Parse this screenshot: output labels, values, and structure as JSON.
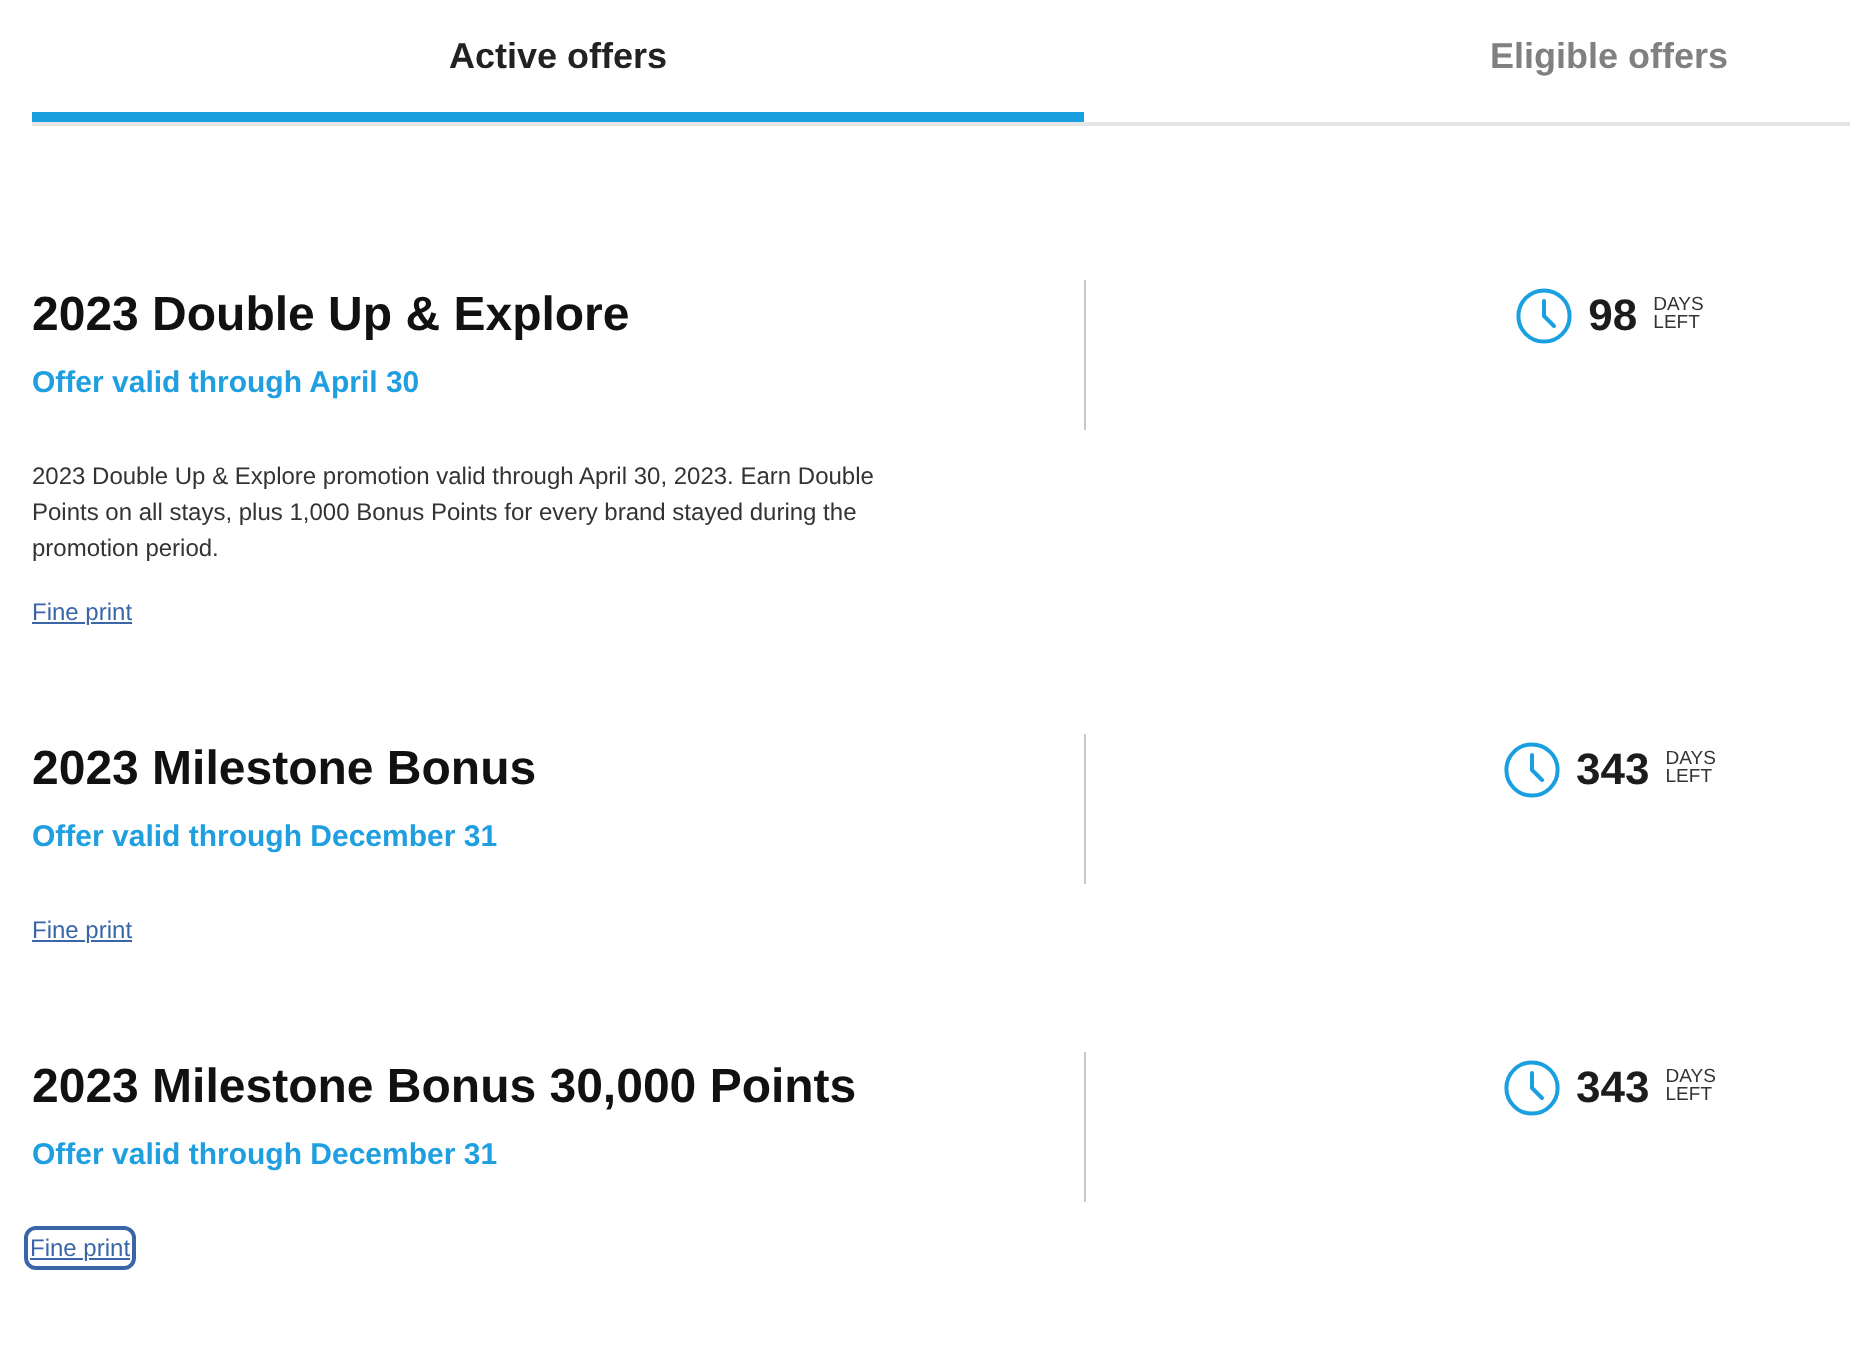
{
  "tabs": [
    {
      "label": "Active offers",
      "selected": true
    },
    {
      "label": "Eligible offers",
      "selected": false
    }
  ],
  "offers": [
    {
      "title": "2023 Double Up & Explore",
      "validity": "Offer valid through April 30",
      "description": "2023 Double Up & Explore promotion valid through April 30, 2023. Earn Double Points on all stays, plus 1,000 Bonus Points for every brand stayed during the promotion period.",
      "fine_print": {
        "label": "Fine print",
        "focused": false
      },
      "days": "98",
      "days_label": "DAYS LEFT"
    },
    {
      "title": "2023 Milestone Bonus",
      "validity": "Offer valid through December 31",
      "fine_print": {
        "label": "Fine print",
        "focused": false
      },
      "days": "343",
      "days_label": "DAYS LEFT"
    },
    {
      "title": "2023 Milestone Bonus 30,000 Points",
      "validity": "Offer valid through December 31",
      "fine_print": {
        "label": "Fine print",
        "focused": true
      },
      "days": "343",
      "days_label": "DAYS LEFT"
    }
  ]
}
